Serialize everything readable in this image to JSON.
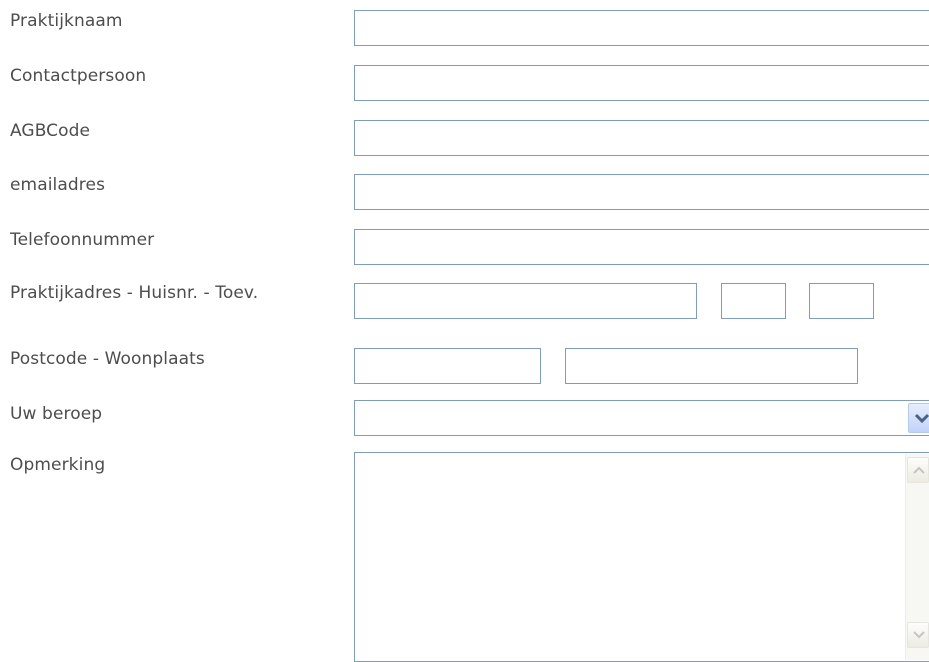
{
  "form": {
    "praktijknaam": {
      "label": "Praktijknaam",
      "value": ""
    },
    "contactpersoon": {
      "label": "Contactpersoon",
      "value": ""
    },
    "agbcode": {
      "label": "AGBCode",
      "value": ""
    },
    "email": {
      "label": "emailadres",
      "value": ""
    },
    "telefoon": {
      "label": "Telefoonnummer",
      "value": ""
    },
    "adres": {
      "label": "Praktijkadres - Huisnr. - Toev.",
      "straat": "",
      "huisnummer": "",
      "toevoeging": ""
    },
    "postcode_woonplaats": {
      "label": "Postcode - Woonplaats",
      "postcode": "",
      "woonplaats": ""
    },
    "beroep": {
      "label": "Uw beroep",
      "selected": ""
    },
    "opmerking": {
      "label": "Opmerking",
      "value": ""
    }
  },
  "icons": {
    "select_arrow": "chevron-down-icon",
    "scroll_up": "scroll-up-arrow-icon",
    "scroll_down": "scroll-down-arrow-icon"
  },
  "colors": {
    "label_text": "#4d4d4d",
    "field_border": "#7f9db9",
    "select_button": "#c1d3fb"
  }
}
